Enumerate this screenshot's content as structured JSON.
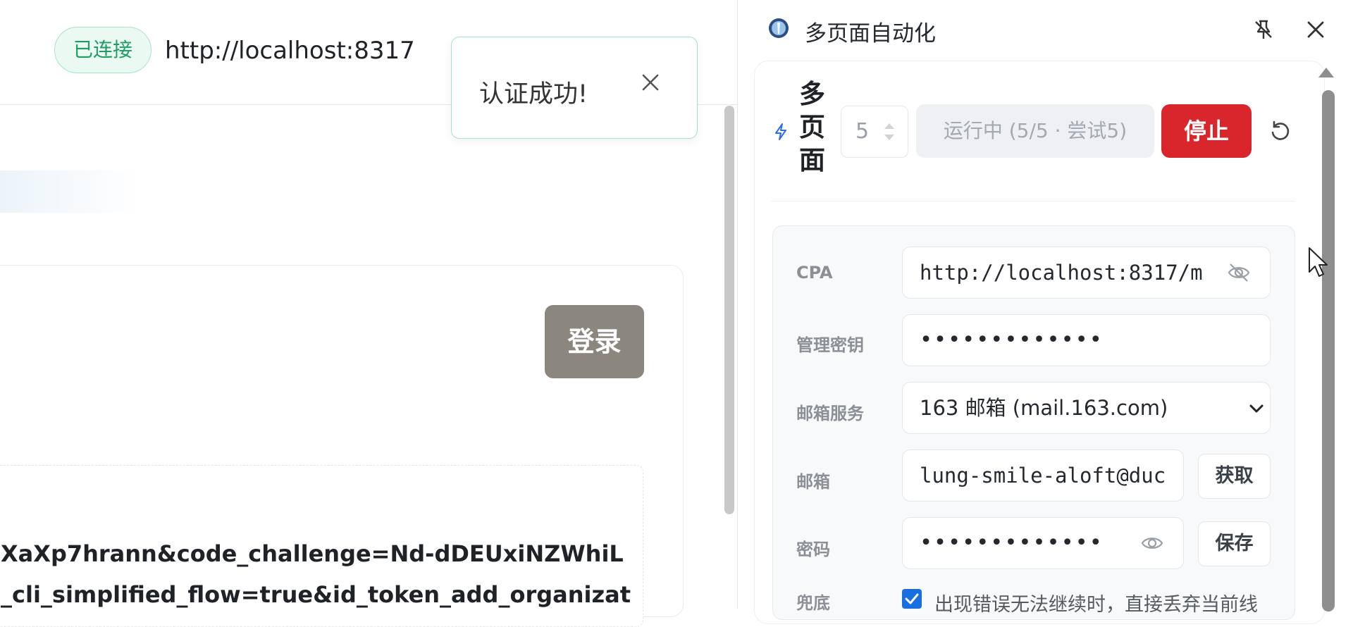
{
  "left": {
    "status_badge": "已连接",
    "server_url": "http://localhost:8317",
    "toast": {
      "message": "认证成功!"
    },
    "login_button": "登录",
    "code_lines": [
      "XaXp7hrann&code_challenge=Nd-dDEUxiNZWhiL",
      "_cli_simplified_flow=true&id_token_add_organizat"
    ]
  },
  "panel": {
    "title": "多页面自动化",
    "multipage_label": [
      "多",
      "页",
      "面"
    ],
    "page_count": "5",
    "running_status": "运行中 (5/5 · 尝试5)",
    "stop_label": "停止",
    "fields": {
      "cpa": {
        "label": "CPA",
        "value": "http://localhost:8317/m"
      },
      "admin_key": {
        "label": "管理密钥",
        "value": "•••••••••••••"
      },
      "mail_service": {
        "label": "邮箱服务",
        "value": "163 邮箱 (mail.163.com)"
      },
      "email": {
        "label": "邮箱",
        "value": "lung-smile-aloft@duc",
        "button": "获取"
      },
      "password": {
        "label": "密码",
        "value": "•••••••••••••",
        "button": "保存"
      },
      "fallback": {
        "label": "兜底",
        "checked": true,
        "text": "出现错误无法继续时，直接丢弃当前线"
      }
    }
  },
  "colors": {
    "connected_green": "#1f9d63",
    "stop_red": "#d9262c",
    "login_gray": "#8b877f",
    "checkbox_blue": "#1a6fe0"
  }
}
